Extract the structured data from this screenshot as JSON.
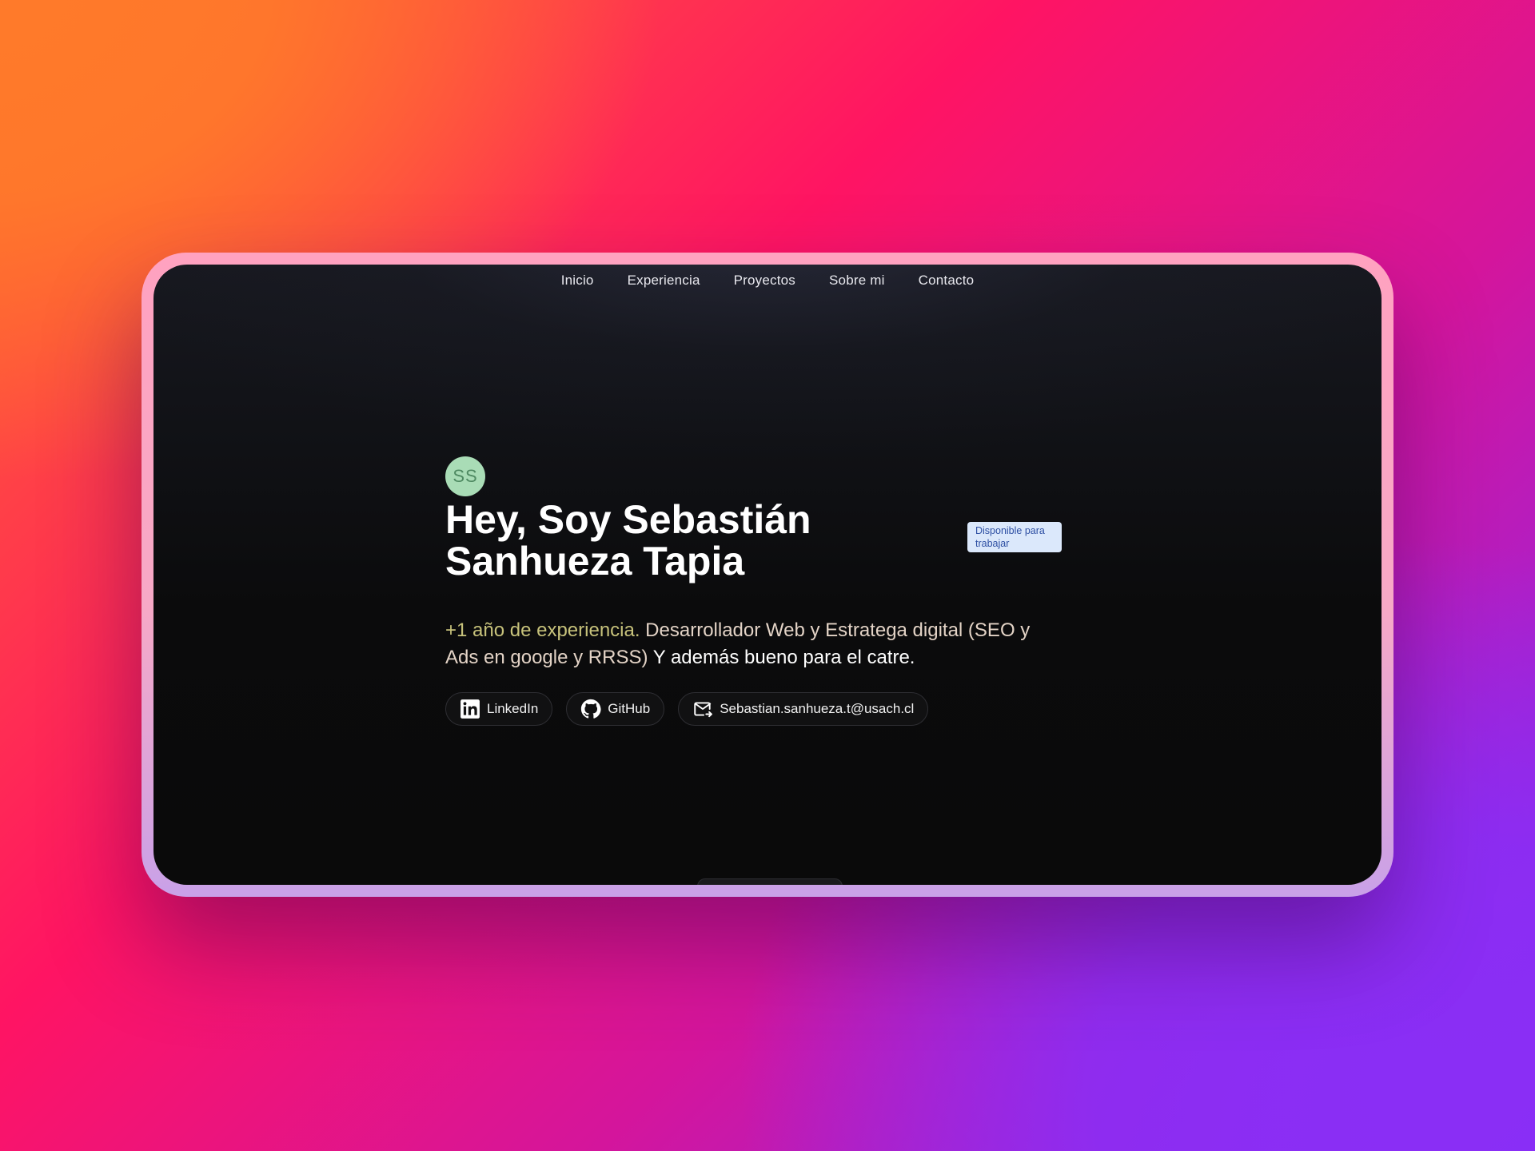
{
  "nav": {
    "items": [
      {
        "label": "Inicio"
      },
      {
        "label": "Experiencia"
      },
      {
        "label": "Proyectos"
      },
      {
        "label": "Sobre mi"
      },
      {
        "label": "Contacto"
      }
    ]
  },
  "hero": {
    "avatar_initials": "SS",
    "title": "Hey, Soy Sebastián Sanhueza Tapia",
    "badge": "Disponible para trabajar",
    "description": {
      "highlight": "+1 año de experiencia.",
      "main": " Desarrollador Web y Estratega digital (SEO y Ads en google y RRSS)",
      "extra": " Y además bueno para el catre."
    },
    "links": [
      {
        "label": "LinkedIn",
        "icon": "linkedin-icon"
      },
      {
        "label": "GitHub",
        "icon": "github-icon"
      },
      {
        "label": "Sebastian.sanhueza.t@usach.cl",
        "icon": "mail-icon"
      }
    ]
  },
  "colors": {
    "accent_highlight": "#c7c27b",
    "avatar_bg": "#a9dcb6",
    "badge_bg": "#dbe8fb",
    "badge_text": "#2d4fa3"
  }
}
